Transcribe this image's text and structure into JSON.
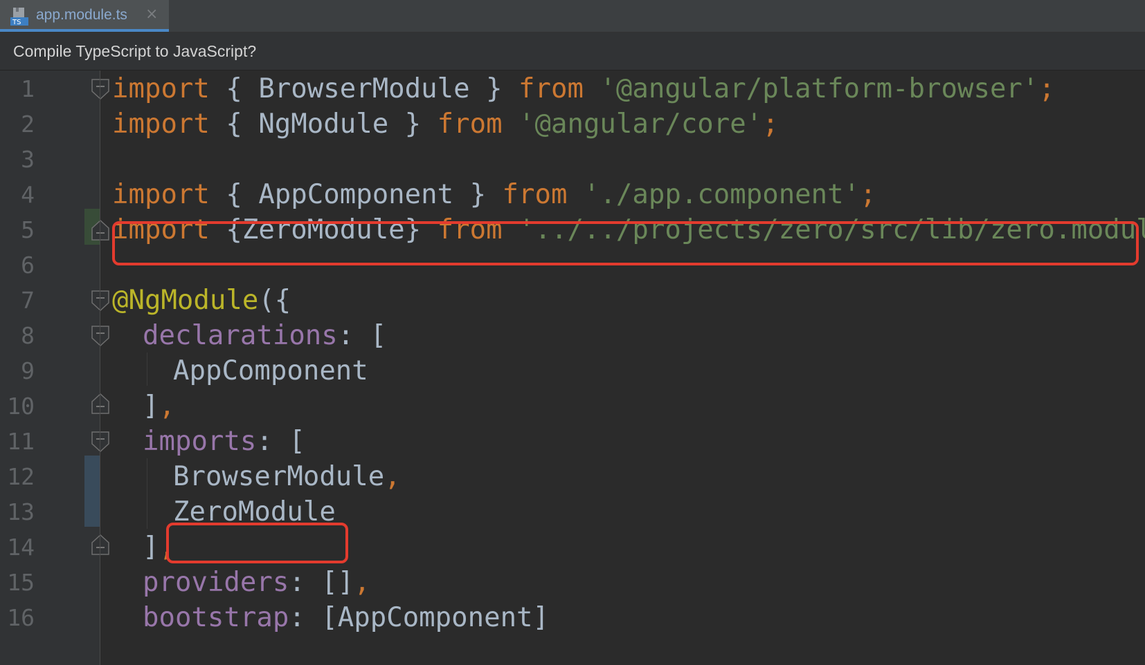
{
  "tab": {
    "label": "app.module.ts",
    "icon": "typescript-file-icon",
    "close_symbol": "×"
  },
  "banner": {
    "text": "Compile TypeScript to JavaScript?"
  },
  "code": {
    "line_numbers": [
      "1",
      "2",
      "3",
      "4",
      "5",
      "6",
      "7",
      "8",
      "9",
      "10",
      "11",
      "12",
      "13",
      "14",
      "15",
      "16"
    ],
    "l1": {
      "k1": "import",
      "p1": " { BrowserModule } ",
      "k2": "from",
      "sp": " ",
      "s": "'@angular/platform-browser'",
      "semi": ";"
    },
    "l2": {
      "k1": "import",
      "p1": " { NgModule } ",
      "k2": "from",
      "sp": " ",
      "s": "'@angular/core'",
      "semi": ";"
    },
    "l4": {
      "k1": "import",
      "p1": " { AppComponent } ",
      "k2": "from",
      "sp": " ",
      "s": "'./app.component'",
      "semi": ";"
    },
    "l5": {
      "k1": "import",
      "p1": " {ZeroModule} ",
      "k2": "from",
      "sp": " ",
      "s": "'../../projects/zero/src/lib/zero.module'",
      "semi": ";"
    },
    "l7": {
      "d": "@NgModule",
      "p": "({"
    },
    "l8": {
      "prop": "declarations",
      "p": ": ["
    },
    "l9": {
      "t": "AppComponent"
    },
    "l10": {
      "p": "]",
      "c": ","
    },
    "l11": {
      "prop": "imports",
      "p": ": ["
    },
    "l12": {
      "t": "BrowserModule",
      "c": ","
    },
    "l13": {
      "t": "ZeroModule"
    },
    "l14": {
      "p": "]",
      "c": ","
    },
    "l15": {
      "prop": "providers",
      "p": ": []",
      "c": ","
    },
    "l16": {
      "prop": "bootstrap",
      "p": ": [AppComponent]"
    }
  },
  "colors": {
    "keyword": "#cc7832",
    "string": "#6a8759",
    "decorator": "#bbb529",
    "property": "#9876aa",
    "plain": "#a9b7c6",
    "highlight_box": "#e33b2e"
  }
}
